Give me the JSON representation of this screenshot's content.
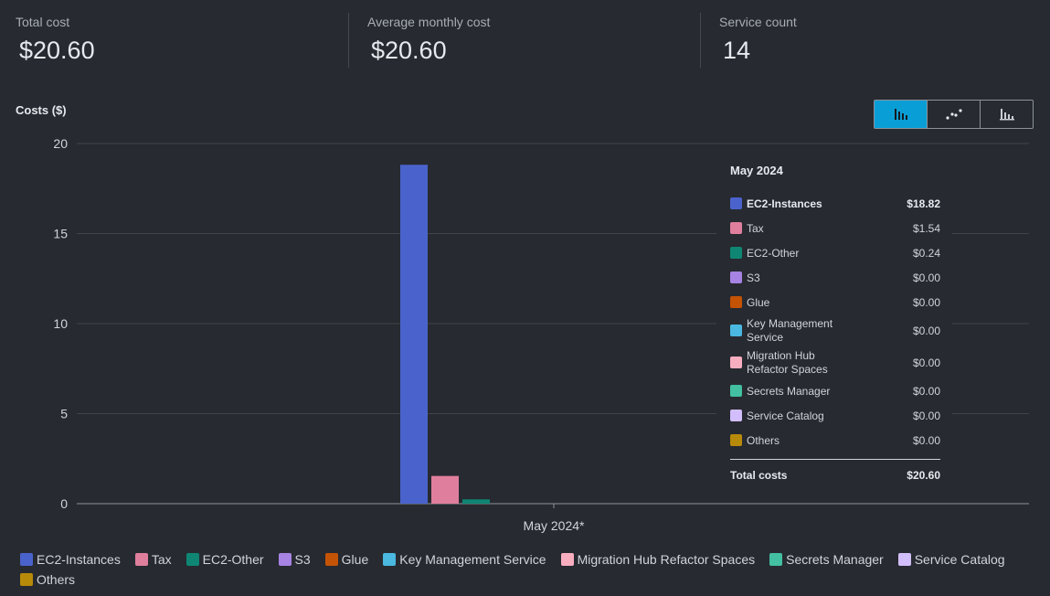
{
  "summary": {
    "total_cost": {
      "label": "Total cost",
      "value": "$20.60"
    },
    "avg_monthly": {
      "label": "Average monthly cost",
      "value": "$20.60"
    },
    "service_count": {
      "label": "Service count",
      "value": "14"
    }
  },
  "chart_data": {
    "type": "bar",
    "title": "",
    "ylabel": "Costs ($)",
    "xlabel": "",
    "ylim": [
      0,
      20
    ],
    "y_ticks": [
      "0",
      "5",
      "10",
      "15",
      "20"
    ],
    "categories": [
      "May 2024*"
    ],
    "series": [
      {
        "name": "EC2-Instances",
        "color": "#4a63cc",
        "values": [
          18.82
        ]
      },
      {
        "name": "Tax",
        "color": "#e07f9d",
        "values": [
          1.54
        ]
      },
      {
        "name": "EC2-Other",
        "color": "#0f8674",
        "values": [
          0.24
        ]
      },
      {
        "name": "S3",
        "color": "#a783e3",
        "values": [
          0.0
        ]
      },
      {
        "name": "Glue",
        "color": "#c55305",
        "values": [
          0.0
        ]
      },
      {
        "name": "Key Management Service",
        "color": "#4ab8e0",
        "values": [
          0.0
        ]
      },
      {
        "name": "Migration Hub Refactor Spaces",
        "color": "#f9aec0",
        "values": [
          0.0
        ]
      },
      {
        "name": "Secrets Manager",
        "color": "#42c0a1",
        "values": [
          0.0
        ]
      },
      {
        "name": "Service Catalog",
        "color": "#d2befa",
        "values": [
          0.0
        ]
      },
      {
        "name": "Others",
        "color": "#b88a09",
        "values": [
          0.0
        ]
      }
    ],
    "grid": true,
    "legend_position": "bottom-left"
  },
  "toggle": {
    "active": "bar-chart-icon",
    "icons": [
      "bar-chart-icon",
      "line-chart-icon",
      "stacked-bar-chart-icon"
    ]
  },
  "tooltip": {
    "title": "May 2024",
    "rows": [
      {
        "name": "EC2-Instances",
        "amount": "$18.82"
      },
      {
        "name": "Tax",
        "amount": "$1.54"
      },
      {
        "name": "EC2-Other",
        "amount": "$0.24"
      },
      {
        "name": "S3",
        "amount": "$0.00"
      },
      {
        "name": "Glue",
        "amount": "$0.00"
      },
      {
        "name": "Key Management Service",
        "amount": "$0.00"
      },
      {
        "name": "Migration Hub Refactor Spaces",
        "amount": "$0.00"
      },
      {
        "name": "Secrets Manager",
        "amount": "$0.00"
      },
      {
        "name": "Service Catalog",
        "amount": "$0.00"
      },
      {
        "name": "Others",
        "amount": "$0.00"
      }
    ],
    "total_label": "Total costs",
    "total_amount": "$20.60"
  }
}
